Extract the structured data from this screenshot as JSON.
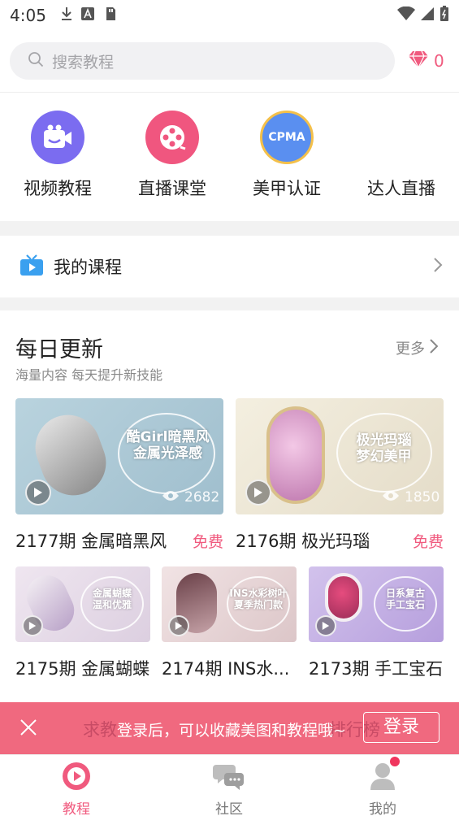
{
  "status_bar": {
    "time": "4:05"
  },
  "search": {
    "placeholder": "搜索教程"
  },
  "gems": {
    "count": "0"
  },
  "categories": [
    {
      "label": "视频教程",
      "icon": "video-camera-icon",
      "color": "#7b6cf0"
    },
    {
      "label": "直播课堂",
      "icon": "film-reel-icon",
      "color": "#f0567f"
    },
    {
      "label": "美甲认证",
      "icon": "cpma-badge-icon",
      "color": "#5a8ff0",
      "badge_text": "CPMA"
    },
    {
      "label": "达人直播",
      "icon": "live-icon",
      "color": "#f0567f"
    }
  ],
  "my_course": {
    "label": "我的课程"
  },
  "daily": {
    "title": "每日更新",
    "subtitle": "海量内容 每天提升新技能",
    "more": "更多",
    "big_cards": [
      {
        "caption": "2177期 金属暗黑风",
        "tag": "免费",
        "views": "2682",
        "thumb_text": "酷Girl暗黑风\n金属光泽感",
        "bg": "#a9c6d3"
      },
      {
        "caption": "2176期 极光玛瑙",
        "tag": "免费",
        "views": "1850",
        "thumb_text": "极光玛瑙\n梦幻美甲",
        "bg": "#ece6d6"
      }
    ],
    "small_cards": [
      {
        "caption": "2175期 金属蝴蝶",
        "thumb_text": "金属蝴蝶\n温和优雅",
        "bg": "#e7dce9"
      },
      {
        "caption": "2174期 INS水...",
        "thumb_text": "INS水彩树叶\n夏季热门款",
        "bg": "#e8d7d9"
      },
      {
        "caption": "2173期 手工宝石",
        "thumb_text": "日系复古\n手工宝石",
        "bg": "#c7b3e6"
      }
    ]
  },
  "login_banner": {
    "behind_left": "求教",
    "behind_right": "排行榜",
    "message": "登录后，可以收藏美图和教程哦~",
    "button": "登录"
  },
  "tabs": [
    {
      "label": "教程",
      "icon": "play-circle-icon",
      "active": true
    },
    {
      "label": "社区",
      "icon": "chat-bubbles-icon",
      "active": false
    },
    {
      "label": "我的",
      "icon": "person-icon",
      "active": false
    }
  ],
  "colors": {
    "accent": "#f05a7e",
    "banner": "#f0697f"
  }
}
